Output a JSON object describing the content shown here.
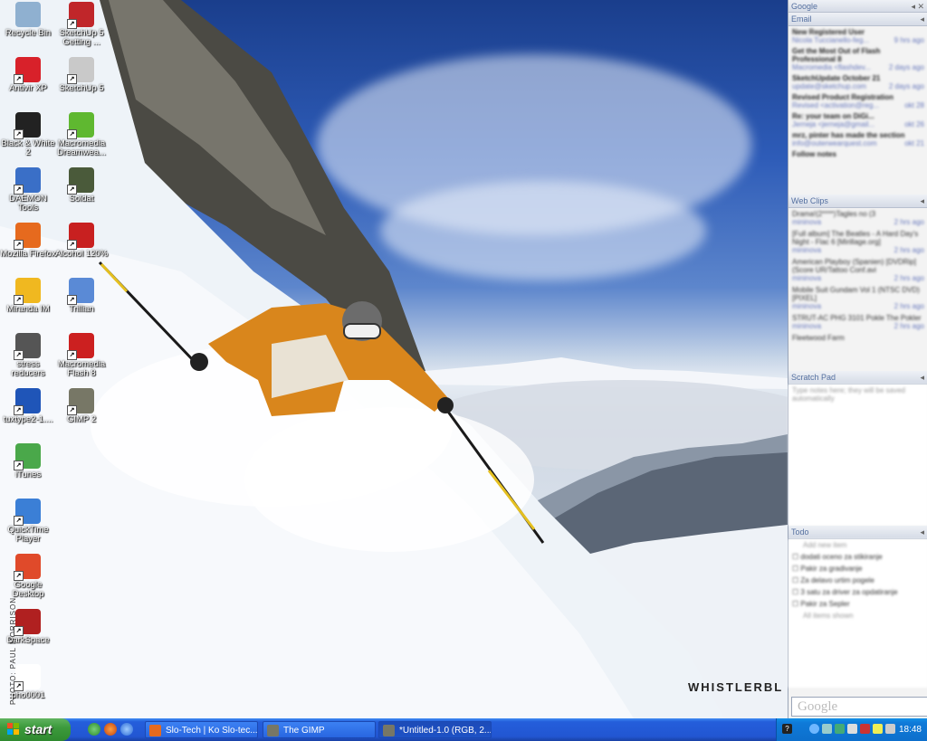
{
  "desktop": {
    "watermark": "WHISTLERBL",
    "photo_credit": "PHOTO: PAUL MORRISON",
    "icons": [
      {
        "label": "Recycle Bin",
        "icon": "recycle-bin-icon",
        "color": "#8fb0d0"
      },
      {
        "label": "SketchUp 5 Getting ...",
        "icon": "sketchup-icon",
        "color": "#c0262a"
      },
      {
        "label": "Antivir XP",
        "icon": "antivir-icon",
        "color": "#d8212a"
      },
      {
        "label": "SketchUp 5",
        "icon": "sketchup-icon",
        "color": "#c9c9c9"
      },
      {
        "label": "Black & White 2",
        "icon": "black-white-icon",
        "color": "#222222"
      },
      {
        "label": "Macromedia Dreamwea...",
        "icon": "dreamweaver-icon",
        "color": "#5fb830"
      },
      {
        "label": "DAEMON Tools",
        "icon": "daemon-tools-icon",
        "color": "#3a6fc7"
      },
      {
        "label": "Soldat",
        "icon": "soldat-icon",
        "color": "#4a5a3a"
      },
      {
        "label": "Mozilla Firefox",
        "icon": "firefox-icon",
        "color": "#e66a1e"
      },
      {
        "label": "Alcohol 120%",
        "icon": "alcohol-icon",
        "color": "#c82020"
      },
      {
        "label": "Miranda IM",
        "icon": "miranda-icon",
        "color": "#f0b820"
      },
      {
        "label": "Trillian",
        "icon": "trillian-icon",
        "color": "#5a8ad6"
      },
      {
        "label": "stress reducers",
        "icon": "stress-reducers-icon",
        "color": "#555555"
      },
      {
        "label": "Macromedia Flash 8",
        "icon": "flash-icon",
        "color": "#cc2020"
      },
      {
        "label": "tuxtype2-1....",
        "icon": "tuxtype-icon",
        "color": "#1f55b8"
      },
      {
        "label": "GIMP 2",
        "icon": "gimp-icon",
        "color": "#777766"
      },
      {
        "label": "iTunes",
        "icon": "itunes-icon",
        "color": "#4aa84a"
      },
      {
        "label": "QuickTime Player",
        "icon": "quicktime-icon",
        "color": "#3b7fd6"
      },
      {
        "label": "Google Desktop",
        "icon": "google-desktop-icon",
        "color": "#e04a2a"
      },
      {
        "label": "DarkSpace",
        "icon": "darkspace-icon",
        "color": "#b02020"
      },
      {
        "label": "pho0001",
        "icon": "image-file-icon",
        "color": "#ffffff"
      }
    ]
  },
  "sidebar": {
    "header": "Google",
    "email": {
      "title": "Email",
      "items": [
        {
          "subject": "New Registered User",
          "from": "Nicola Tuccianello-feg...",
          "time": "9 hrs ago"
        },
        {
          "subject": "Get the Most Out of Flash Professional 8",
          "from": "Macromedia <flashdev...",
          "time": "2 days ago"
        },
        {
          "subject": "SketchUpdate October 21",
          "from": "update@sketchup.com",
          "time": "2 days ago"
        },
        {
          "subject": "Revised Product Registration",
          "from": "Revised <activation@reg...",
          "time": "okt 28"
        },
        {
          "subject": "Re: your team on DiGi...",
          "from": "Jerneja <jerneja@gmail...",
          "time": "okt 26"
        },
        {
          "subject": "mrz, pinter has made the section",
          "from": "info@outerwearquest.com",
          "time": "okt 21"
        }
      ],
      "footer": "Follow notes"
    },
    "webclips": {
      "title": "Web Clips",
      "items": [
        {
          "text": "Drama!(2****)Tagles no (3",
          "src": "mininova",
          "time": "2 hrs ago"
        },
        {
          "text": "[Full album] The Beatles - A Hard Day's Night - Flac 6 [Mirillage.org]",
          "src": "mininova",
          "time": "2 hrs ago"
        },
        {
          "text": "American Playboy (Spanien) [DVDRip] (Score UR/Tattoo Conf.avi",
          "src": "mininova",
          "time": "2 hrs ago"
        },
        {
          "text": "Mobile Suit Gundam Vol 1 (NTSC DVD) [PIXEL]",
          "src": "mininova",
          "time": "2 hrs ago"
        },
        {
          "text": "STRUT-AC PHG 3101 Pokle The Pokler",
          "src": "mininova",
          "time": "2 hrs ago"
        },
        {
          "text": "Fleetwood Farm",
          "src": "",
          "time": ""
        }
      ]
    },
    "scratchpad": {
      "title": "Scratch Pad",
      "placeholder": "Type notes here; they will be saved automatically"
    },
    "todo": {
      "title": "Todo",
      "add": "Add new item",
      "items": [
        "dodati oceno za stikiranje",
        "Pakir za gradivanje",
        "Za delavo urtim pogele",
        "3 satu za driver za opdatiranje",
        "Pakir za Sepler"
      ],
      "footer": "All items shown"
    },
    "search_logo": "Google"
  },
  "taskbar": {
    "start_label": "start",
    "tasks": [
      {
        "label": "Slo-Tech | Ko Slo-tec...",
        "icon": "firefox-icon",
        "color": "#e66a1e"
      },
      {
        "label": "The GIMP",
        "icon": "gimp-icon",
        "color": "#777766"
      },
      {
        "label": "*Untitled-1.0 (RGB, 2...",
        "icon": "gimp-icon",
        "color": "#777766"
      }
    ],
    "clock": "18:48"
  }
}
